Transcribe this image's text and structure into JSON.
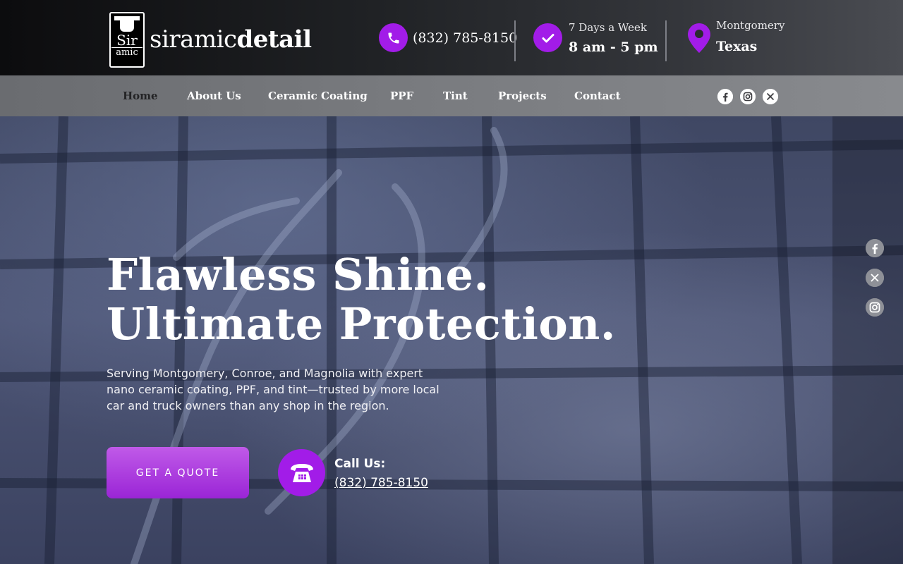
{
  "header": {
    "logo": {
      "badge_top": "Sir",
      "badge_bottom": "amic",
      "brand_light": "siramic",
      "brand_bold": "detail"
    },
    "phone": {
      "icon": "phone-icon",
      "number": "(832) 785-8150"
    },
    "hours": {
      "icon": "check-icon",
      "line1": "7 Days a Week",
      "line2": "8 am - 5 pm"
    },
    "location": {
      "icon": "map-pin-icon",
      "line1": "Montgomery",
      "line2": "Texas"
    }
  },
  "nav": {
    "items": [
      {
        "label": "Home",
        "active": true
      },
      {
        "label": "About Us"
      },
      {
        "label": "Ceramic Coating"
      },
      {
        "label": "PPF"
      },
      {
        "label": "Tint"
      },
      {
        "label": "Projects"
      },
      {
        "label": "Contact"
      }
    ],
    "social": [
      "facebook-icon",
      "instagram-icon",
      "x-icon"
    ]
  },
  "hero": {
    "title_line1": "Flawless Shine.",
    "title_line2": "Ultimate Protection.",
    "subtitle": "Serving Montgomery, Conroe, and Magnolia with expert nano ceramic coating, PPF, and tint—trusted by more local car and truck owners than any shop in the region.",
    "cta_label": "GET A QUOTE",
    "call_label": "Call Us:",
    "call_number": "(832) 785-8150"
  },
  "side_social": [
    "facebook-icon",
    "x-icon",
    "instagram-icon"
  ],
  "colors": {
    "accent": "#a21ce8",
    "nav_bg": "#7a7c80",
    "active_nav": "#232325"
  }
}
